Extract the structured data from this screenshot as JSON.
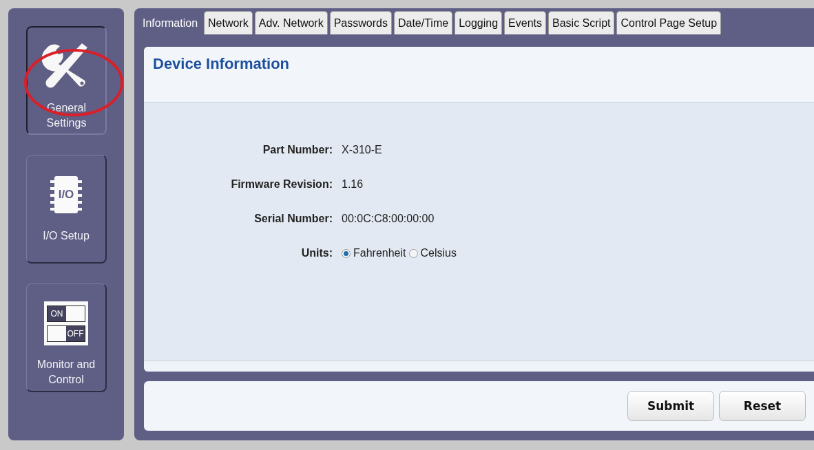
{
  "sidebar": {
    "items": [
      {
        "kind": "tools",
        "label": "General Settings",
        "selected": true
      },
      {
        "kind": "chip",
        "label": "I/O Setup",
        "icon_text": "I/O",
        "selected": false
      },
      {
        "kind": "switch",
        "label": "Monitor and Control",
        "icon_texts": [
          "ON",
          "OFF"
        ],
        "selected": false
      }
    ]
  },
  "tabs": [
    {
      "label": "Information",
      "selected": true
    },
    {
      "label": "Network",
      "selected": false
    },
    {
      "label": "Adv. Network",
      "selected": false
    },
    {
      "label": "Passwords",
      "selected": false
    },
    {
      "label": "Date/Time",
      "selected": false
    },
    {
      "label": "Logging",
      "selected": false
    },
    {
      "label": "Events",
      "selected": false
    },
    {
      "label": "Basic Script",
      "selected": false
    },
    {
      "label": "Control Page Setup",
      "selected": false
    }
  ],
  "panel": {
    "title": "Device Information",
    "fields": [
      {
        "label": "Part Number:",
        "value": "X-310-E"
      },
      {
        "label": "Firmware Revision:",
        "value": "1.16"
      },
      {
        "label": "Serial Number:",
        "value": "00:0C:C8:00:00:00"
      }
    ],
    "units": {
      "label": "Units:",
      "options": [
        {
          "label": "Fahrenheit",
          "selected": true
        },
        {
          "label": "Celsius",
          "selected": false
        }
      ]
    }
  },
  "buttons": [
    "Submit",
    "Reset"
  ]
}
